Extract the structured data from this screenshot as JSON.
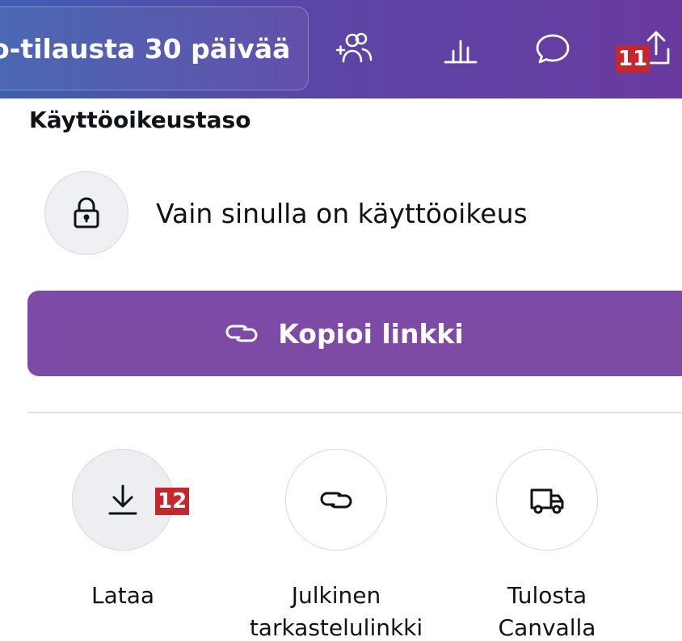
{
  "topbar": {
    "trial_label": "o-tilausta 30 päivää",
    "icons": [
      "add-people-icon",
      "insights-icon",
      "comment-icon",
      "share-icon"
    ]
  },
  "badges": {
    "share": "11",
    "download": "12"
  },
  "access": {
    "title": "Käyttöoikeustaso",
    "value": "Vain sinulla on käyttöoikeus",
    "icon": "lock-icon"
  },
  "copy_link": {
    "label": "Kopioi linkki",
    "icon": "link-icon"
  },
  "actions": [
    {
      "label": "Lataa",
      "icon": "download-icon"
    },
    {
      "label": "Julkinen\ntarkastelulinkki",
      "icon": "link-icon"
    },
    {
      "label": "Tulosta\nCanvalla",
      "icon": "truck-icon"
    }
  ],
  "colors": {
    "accent": "#7d4aa6",
    "badge": "#c8262d",
    "header_start": "#3f5fb0",
    "header_end": "#6a3aa0"
  }
}
